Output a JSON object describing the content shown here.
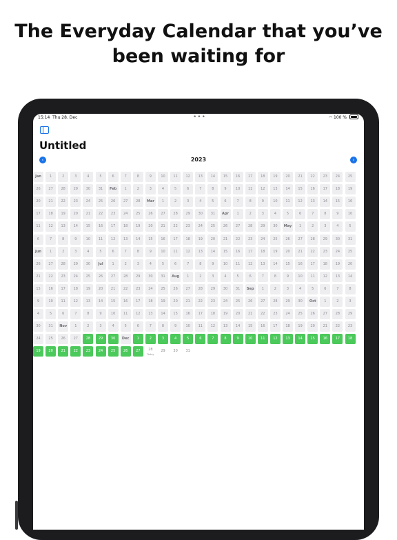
{
  "headline": "The Everyday Calendar that you’ve been waiting for",
  "status_bar": {
    "time": "15:14",
    "date": "Thu 28. Dec",
    "battery": "100 %"
  },
  "calendar": {
    "title": "Untitled",
    "year": "2023",
    "today_label": "Today",
    "completed_until_day_of_year": 361,
    "days_in_year": 365,
    "month_labels": [
      "Jan",
      "Feb",
      "Mar",
      "Apr",
      "May",
      "Jun",
      "Jul",
      "Aug",
      "Sep",
      "Oct",
      "Nov",
      "Dec"
    ],
    "month_lengths": [
      31,
      28,
      31,
      30,
      31,
      30,
      31,
      31,
      30,
      31,
      30,
      31
    ]
  },
  "colors": {
    "accent": "#1a73e8",
    "done": "#4bc95a",
    "cell": "#eeeef1"
  }
}
